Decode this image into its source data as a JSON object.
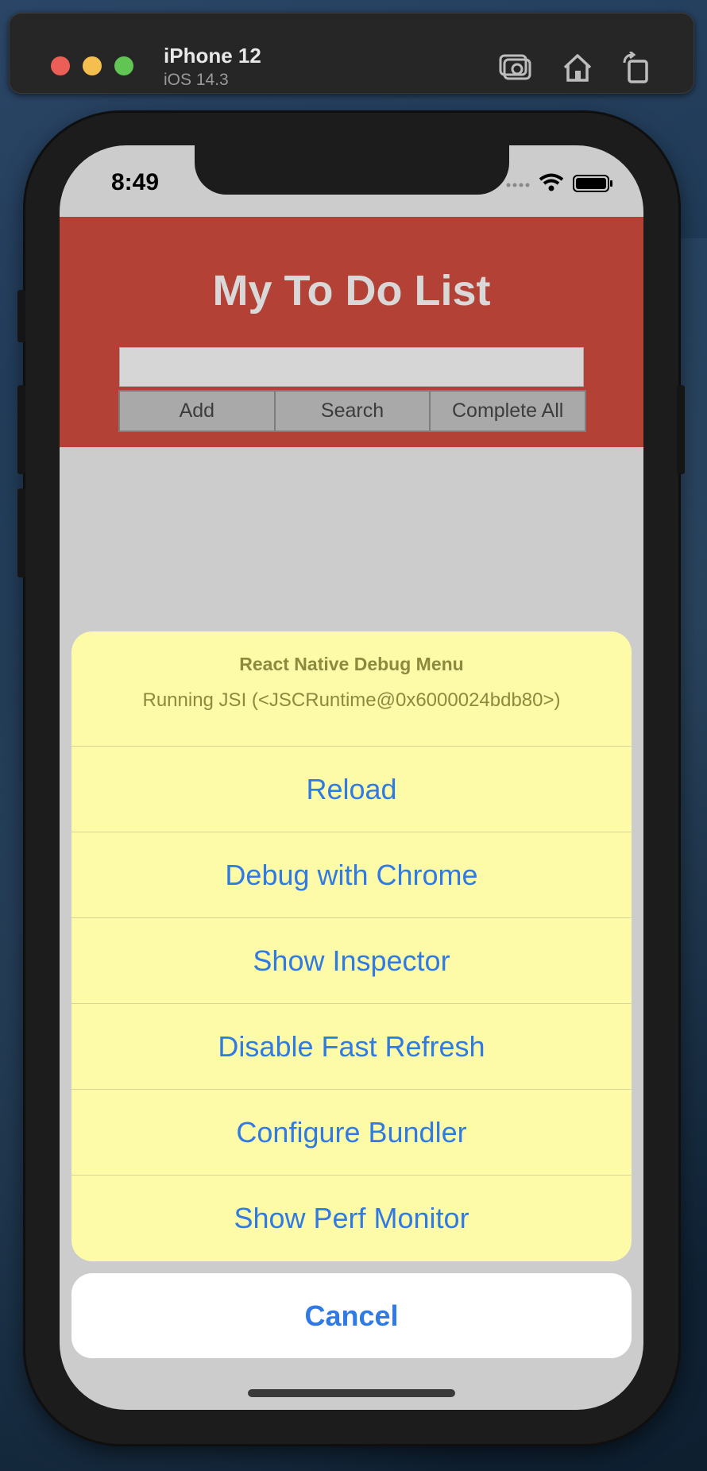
{
  "simulator": {
    "device_name": "iPhone 12",
    "os_version": "iOS 14.3",
    "toolbar_icons": [
      "screenshot-icon",
      "home-icon",
      "rotate-icon"
    ]
  },
  "status_bar": {
    "time": "8:49",
    "icons": [
      "cellular-icon",
      "wifi-icon",
      "battery-icon"
    ]
  },
  "app": {
    "title": "My To Do List",
    "input": {
      "value": "",
      "placeholder": ""
    },
    "buttons": {
      "add": "Add",
      "search": "Search",
      "complete_all": "Complete All"
    },
    "header_color": "#b44135"
  },
  "debug_menu": {
    "title": "React Native Debug Menu",
    "subtitle": "Running JSI (<JSCRuntime@0x6000024bdb80>)",
    "items": [
      {
        "label": "Reload"
      },
      {
        "label": "Debug with Chrome"
      },
      {
        "label": "Show Inspector"
      },
      {
        "label": "Disable Fast Refresh"
      },
      {
        "label": "Configure Bundler"
      },
      {
        "label": "Show Perf Monitor"
      }
    ],
    "cancel": "Cancel",
    "background_color": "#fdfaa8",
    "action_color": "#2f7ae5"
  }
}
